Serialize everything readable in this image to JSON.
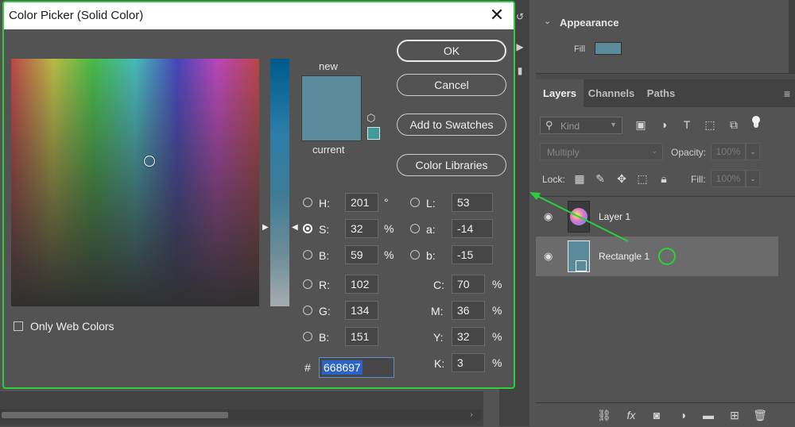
{
  "dialog": {
    "title": "Color Picker (Solid Color)",
    "close_glyph": "✕",
    "buttons": {
      "ok": "OK",
      "cancel": "Cancel",
      "add_swatches": "Add to Swatches",
      "color_libraries": "Color Libraries"
    },
    "new_label": "new",
    "current_label": "current",
    "new_color": "#5b8a9b",
    "current_color": "#5b8a9b",
    "websafe_color": "#3f9a9a",
    "only_web_colors": {
      "label": "Only Web Colors",
      "checked": false
    },
    "fields": {
      "H": {
        "label": "H:",
        "value": "201",
        "unit": "°",
        "selected": false
      },
      "S": {
        "label": "S:",
        "value": "32",
        "unit": "%",
        "selected": true
      },
      "Bv": {
        "label": "B:",
        "value": "59",
        "unit": "%",
        "selected": false
      },
      "R": {
        "label": "R:",
        "value": "102",
        "selected": false
      },
      "G": {
        "label": "G:",
        "value": "134",
        "selected": false
      },
      "Bc": {
        "label": "B:",
        "value": "151",
        "selected": false
      },
      "L": {
        "label": "L:",
        "value": "53",
        "selected": false
      },
      "a": {
        "label": "a:",
        "value": "-14",
        "selected": false
      },
      "b": {
        "label": "b:",
        "value": "-15",
        "selected": false
      },
      "C": {
        "label": "C:",
        "value": "70",
        "unit": "%"
      },
      "M": {
        "label": "M:",
        "value": "36",
        "unit": "%"
      },
      "Y": {
        "label": "Y:",
        "value": "32",
        "unit": "%"
      },
      "K": {
        "label": "K:",
        "value": "3",
        "unit": "%"
      }
    },
    "hex": {
      "hash": "#",
      "value": "668697"
    }
  },
  "appearance": {
    "title": "Appearance",
    "fill_label": "Fill",
    "fill_color": "#5b8a9b"
  },
  "layers_panel": {
    "tabs": [
      "Layers",
      "Channels",
      "Paths"
    ],
    "active_tab": "Layers",
    "filter_kind": "Kind",
    "blend_mode": "Multiply",
    "opacity_label": "Opacity:",
    "opacity_value": "100%",
    "lock_label": "Lock:",
    "fill_label": "Fill:",
    "fill_value": "100%",
    "layers": [
      {
        "name": "Layer 1",
        "visible": true,
        "selected": false
      },
      {
        "name": "Rectangle 1",
        "visible": true,
        "selected": true
      }
    ]
  },
  "icons": {
    "search": "search-icon",
    "chevron": "chevron-down-icon",
    "eye": "eye-icon",
    "link": "link-icon",
    "fx": "fx-icon",
    "mask": "mask-icon",
    "adjust": "adjustment-icon",
    "folder": "folder-icon",
    "new_layer": "new-layer-icon",
    "trash": "trash-icon"
  },
  "colors": {
    "annotation_green": "#2bd03a",
    "accent_blue": "#2b63c6"
  }
}
